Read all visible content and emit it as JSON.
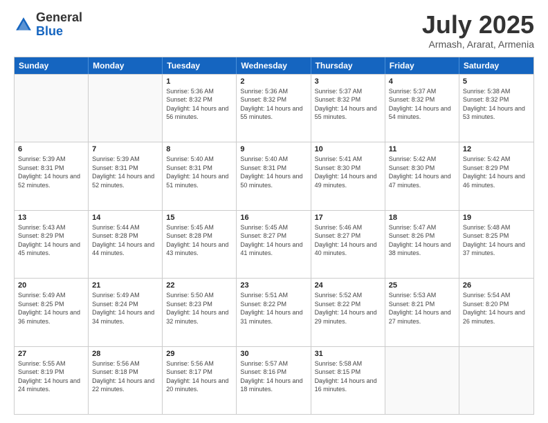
{
  "header": {
    "logo_general": "General",
    "logo_blue": "Blue",
    "month": "July 2025",
    "location": "Armash, Ararat, Armenia"
  },
  "weekdays": [
    "Sunday",
    "Monday",
    "Tuesday",
    "Wednesday",
    "Thursday",
    "Friday",
    "Saturday"
  ],
  "weeks": [
    [
      {
        "day": "",
        "info": ""
      },
      {
        "day": "",
        "info": ""
      },
      {
        "day": "1",
        "info": "Sunrise: 5:36 AM\nSunset: 8:32 PM\nDaylight: 14 hours and 56 minutes."
      },
      {
        "day": "2",
        "info": "Sunrise: 5:36 AM\nSunset: 8:32 PM\nDaylight: 14 hours and 55 minutes."
      },
      {
        "day": "3",
        "info": "Sunrise: 5:37 AM\nSunset: 8:32 PM\nDaylight: 14 hours and 55 minutes."
      },
      {
        "day": "4",
        "info": "Sunrise: 5:37 AM\nSunset: 8:32 PM\nDaylight: 14 hours and 54 minutes."
      },
      {
        "day": "5",
        "info": "Sunrise: 5:38 AM\nSunset: 8:32 PM\nDaylight: 14 hours and 53 minutes."
      }
    ],
    [
      {
        "day": "6",
        "info": "Sunrise: 5:39 AM\nSunset: 8:31 PM\nDaylight: 14 hours and 52 minutes."
      },
      {
        "day": "7",
        "info": "Sunrise: 5:39 AM\nSunset: 8:31 PM\nDaylight: 14 hours and 52 minutes."
      },
      {
        "day": "8",
        "info": "Sunrise: 5:40 AM\nSunset: 8:31 PM\nDaylight: 14 hours and 51 minutes."
      },
      {
        "day": "9",
        "info": "Sunrise: 5:40 AM\nSunset: 8:31 PM\nDaylight: 14 hours and 50 minutes."
      },
      {
        "day": "10",
        "info": "Sunrise: 5:41 AM\nSunset: 8:30 PM\nDaylight: 14 hours and 49 minutes."
      },
      {
        "day": "11",
        "info": "Sunrise: 5:42 AM\nSunset: 8:30 PM\nDaylight: 14 hours and 47 minutes."
      },
      {
        "day": "12",
        "info": "Sunrise: 5:42 AM\nSunset: 8:29 PM\nDaylight: 14 hours and 46 minutes."
      }
    ],
    [
      {
        "day": "13",
        "info": "Sunrise: 5:43 AM\nSunset: 8:29 PM\nDaylight: 14 hours and 45 minutes."
      },
      {
        "day": "14",
        "info": "Sunrise: 5:44 AM\nSunset: 8:28 PM\nDaylight: 14 hours and 44 minutes."
      },
      {
        "day": "15",
        "info": "Sunrise: 5:45 AM\nSunset: 8:28 PM\nDaylight: 14 hours and 43 minutes."
      },
      {
        "day": "16",
        "info": "Sunrise: 5:45 AM\nSunset: 8:27 PM\nDaylight: 14 hours and 41 minutes."
      },
      {
        "day": "17",
        "info": "Sunrise: 5:46 AM\nSunset: 8:27 PM\nDaylight: 14 hours and 40 minutes."
      },
      {
        "day": "18",
        "info": "Sunrise: 5:47 AM\nSunset: 8:26 PM\nDaylight: 14 hours and 38 minutes."
      },
      {
        "day": "19",
        "info": "Sunrise: 5:48 AM\nSunset: 8:25 PM\nDaylight: 14 hours and 37 minutes."
      }
    ],
    [
      {
        "day": "20",
        "info": "Sunrise: 5:49 AM\nSunset: 8:25 PM\nDaylight: 14 hours and 36 minutes."
      },
      {
        "day": "21",
        "info": "Sunrise: 5:49 AM\nSunset: 8:24 PM\nDaylight: 14 hours and 34 minutes."
      },
      {
        "day": "22",
        "info": "Sunrise: 5:50 AM\nSunset: 8:23 PM\nDaylight: 14 hours and 32 minutes."
      },
      {
        "day": "23",
        "info": "Sunrise: 5:51 AM\nSunset: 8:22 PM\nDaylight: 14 hours and 31 minutes."
      },
      {
        "day": "24",
        "info": "Sunrise: 5:52 AM\nSunset: 8:22 PM\nDaylight: 14 hours and 29 minutes."
      },
      {
        "day": "25",
        "info": "Sunrise: 5:53 AM\nSunset: 8:21 PM\nDaylight: 14 hours and 27 minutes."
      },
      {
        "day": "26",
        "info": "Sunrise: 5:54 AM\nSunset: 8:20 PM\nDaylight: 14 hours and 26 minutes."
      }
    ],
    [
      {
        "day": "27",
        "info": "Sunrise: 5:55 AM\nSunset: 8:19 PM\nDaylight: 14 hours and 24 minutes."
      },
      {
        "day": "28",
        "info": "Sunrise: 5:56 AM\nSunset: 8:18 PM\nDaylight: 14 hours and 22 minutes."
      },
      {
        "day": "29",
        "info": "Sunrise: 5:56 AM\nSunset: 8:17 PM\nDaylight: 14 hours and 20 minutes."
      },
      {
        "day": "30",
        "info": "Sunrise: 5:57 AM\nSunset: 8:16 PM\nDaylight: 14 hours and 18 minutes."
      },
      {
        "day": "31",
        "info": "Sunrise: 5:58 AM\nSunset: 8:15 PM\nDaylight: 14 hours and 16 minutes."
      },
      {
        "day": "",
        "info": ""
      },
      {
        "day": "",
        "info": ""
      }
    ]
  ]
}
